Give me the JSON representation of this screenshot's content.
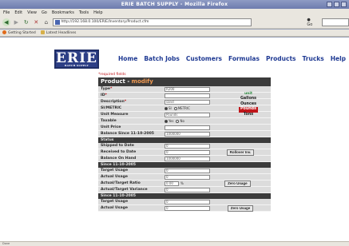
{
  "window": {
    "title": "ERIE BATCH SUPPLY - Mozilla Firefox"
  },
  "menu": [
    "File",
    "Edit",
    "View",
    "Go",
    "Bookmarks",
    "Tools",
    "Help"
  ],
  "nav": {
    "url": "http://192.168.0.100/ERIE/Inventory/Product.cfm",
    "go_label": "Go"
  },
  "bookmarks": [
    "Getting Started",
    "Latest Headlines"
  ],
  "logo": {
    "text": "ERIE",
    "sub": "BATCH SUPPLY"
  },
  "mainnav": [
    "Home",
    "Batch Jobs",
    "Customers",
    "Formulas",
    "Products",
    "Trucks",
    "Help"
  ],
  "form": {
    "required_note": "*required fields",
    "title_prefix": "Product - ",
    "title_mode": "modify",
    "units_header": "unit",
    "units": [
      "Gallons",
      "Ounces",
      "Pounds",
      "Tons"
    ],
    "selected_unit": "Pounds",
    "rows": [
      {
        "label": "Type",
        "req": "*",
        "value": "R200"
      },
      {
        "label": "ID",
        "req": "*",
        "value": ""
      },
      {
        "label": "Description",
        "req": "*",
        "value": "sand"
      },
      {
        "label": "SI/METRIC",
        "req": "",
        "radios": [
          "SI",
          "METRIC"
        ],
        "selected": 0
      },
      {
        "label": "Unit Measure",
        "req": "",
        "value": "Pounds"
      },
      {
        "label": "Taxable",
        "req": "",
        "radios": [
          "Yes",
          "No"
        ],
        "selected": 0
      },
      {
        "label": "Unit Price",
        "req": "",
        "value": ""
      },
      {
        "label": "Balance Since 11-10-2005",
        "req": "",
        "value": "1000000"
      }
    ],
    "status": {
      "header": "Status",
      "rows": [
        {
          "label": "Shipped to Date",
          "value": "0"
        },
        {
          "label": "Received to Date",
          "value": "0"
        },
        {
          "label": "Balance On Hand",
          "value": "1000000"
        }
      ],
      "button": "Rollover Inv."
    },
    "since1": {
      "header": "Since 11-10-2005",
      "rows": [
        {
          "label": "Target Usage",
          "value": "0"
        },
        {
          "label": "Actual Usage",
          "value": "0"
        },
        {
          "label": "Actual/Target Ratio",
          "value": "0.00",
          "suffix": "%"
        },
        {
          "label": "Actual/Target Variance",
          "value": "0"
        }
      ],
      "button": "Zero Usage"
    },
    "since2": {
      "header": "Since 11-10-2005",
      "rows": [
        {
          "label": "Target Usage",
          "value": "0"
        },
        {
          "label": "Actual Usage",
          "value": "0"
        }
      ],
      "button": "Zero Usage"
    }
  },
  "status": {
    "text": "Done"
  }
}
